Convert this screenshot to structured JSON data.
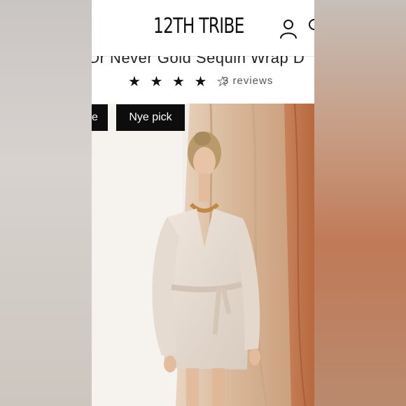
{
  "header": {
    "brand": "12TH TRIBE",
    "account_icon": "user-icon",
    "search_icon": "search-icon"
  },
  "product": {
    "title": "Or Never Gold Sequin Wrap D",
    "rating": 4,
    "rating_max": 5,
    "stars": "★ ★ ★ ★ ☆",
    "reviews": "3 reviews"
  },
  "badges": {
    "left": "e",
    "right": "Nye pick"
  },
  "colors": {
    "badge_bg": "#0d0d0d",
    "backdrop_drape": "#d9b89a",
    "dress": "#e7ddd4"
  }
}
